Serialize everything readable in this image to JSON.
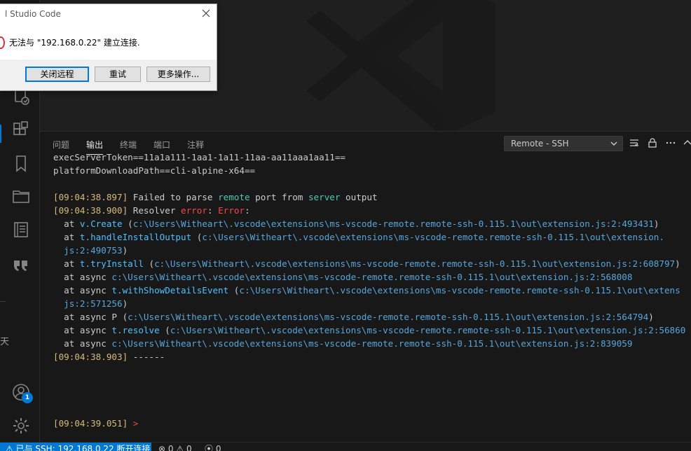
{
  "dialog": {
    "title": "l Studio Code",
    "message": "无法与 \"192.168.0.22\" 建立连接.",
    "buttons": [
      "关闭远程",
      "重试",
      "更多操作..."
    ]
  },
  "activity_bar": {
    "cut_char": "天",
    "accounts_badge": "1"
  },
  "panel": {
    "tabs": [
      "问题",
      "输出",
      "终端",
      "端口",
      "注释"
    ],
    "active_tab": "输出",
    "channel_select": "Remote - SSH"
  },
  "output": {
    "lines": [
      [
        {
          "t": "execServerToken==11a1a111-1aa1-1a11-11aa-aa11aaa1aa11=="
        }
      ],
      [
        {
          "t": "platformDownloadPath==cli-alpine-x64=="
        }
      ],
      [
        {
          "t": ""
        }
      ],
      [
        {
          "t": "[09:04:38.897]",
          "c": "ts"
        },
        {
          "t": " Failed to parse "
        },
        {
          "t": "remote",
          "c": "kw"
        },
        {
          "t": " port from "
        },
        {
          "t": "server",
          "c": "kw"
        },
        {
          "t": " output"
        }
      ],
      [
        {
          "t": "[09:04:38.900]",
          "c": "ts"
        },
        {
          "t": " Resolver "
        },
        {
          "t": "error",
          "c": "err"
        },
        {
          "t": ": "
        },
        {
          "t": "Error",
          "c": "err"
        },
        {
          "t": ":"
        }
      ],
      [
        {
          "t": "  at "
        },
        {
          "t": "v.Create",
          "c": "fn"
        },
        {
          "t": " ("
        },
        {
          "t": "c:\\Users\\Witheart\\.vscode\\extensions\\ms-vscode-remote.remote-ssh-0.115.1\\out\\extension.js:2:493431",
          "c": "path"
        },
        {
          "t": ")"
        }
      ],
      [
        {
          "t": "  at "
        },
        {
          "t": "t.handleInstallOutput",
          "c": "fn"
        },
        {
          "t": " ("
        },
        {
          "t": "c:\\Users\\Witheart\\.vscode\\extensions\\ms-vscode-remote.remote-ssh-0.115.1\\out\\extension.",
          "c": "path"
        }
      ],
      [
        {
          "t": "  js:2:490753",
          "c": "path"
        },
        {
          "t": ")"
        }
      ],
      [
        {
          "t": "  at "
        },
        {
          "t": "t.tryInstall",
          "c": "fn"
        },
        {
          "t": " ("
        },
        {
          "t": "c:\\Users\\Witheart\\.vscode\\extensions\\ms-vscode-remote.remote-ssh-0.115.1\\out\\extension.js:2:608797",
          "c": "path"
        },
        {
          "t": ")"
        }
      ],
      [
        {
          "t": "  at async "
        },
        {
          "t": "c:\\Users\\Witheart\\.vscode\\extensions\\ms-vscode-remote.remote-ssh-0.115.1\\out\\extension.js:2:568008",
          "c": "path"
        }
      ],
      [
        {
          "t": "  at async "
        },
        {
          "t": "t.withShowDetailsEvent",
          "c": "fn"
        },
        {
          "t": " ("
        },
        {
          "t": "c:\\Users\\Witheart\\.vscode\\extensions\\ms-vscode-remote.remote-ssh-0.115.1\\out\\extens",
          "c": "path"
        }
      ],
      [
        {
          "t": "  js:2:571256",
          "c": "path"
        },
        {
          "t": ")"
        }
      ],
      [
        {
          "t": "  at async P ("
        },
        {
          "t": "c:\\Users\\Witheart\\.vscode\\extensions\\ms-vscode-remote.remote-ssh-0.115.1\\out\\extension.js:2:564794",
          "c": "path"
        },
        {
          "t": ")"
        }
      ],
      [
        {
          "t": "  at async "
        },
        {
          "t": "t.resolve",
          "c": "fn"
        },
        {
          "t": " ("
        },
        {
          "t": "c:\\Users\\Witheart\\.vscode\\extensions\\ms-vscode-remote.remote-ssh-0.115.1\\out\\extension.js:2:56860",
          "c": "path"
        }
      ],
      [
        {
          "t": "  at async "
        },
        {
          "t": "c:\\Users\\Witheart\\.vscode\\extensions\\ms-vscode-remote.remote-ssh-0.115.1\\out\\extension.js:2:839059",
          "c": "path"
        }
      ],
      [
        {
          "t": "[09:04:38.903]",
          "c": "ts"
        },
        {
          "t": " ------"
        }
      ],
      [
        {
          "t": ""
        }
      ],
      [
        {
          "t": ""
        }
      ],
      [
        {
          "t": ""
        }
      ],
      [
        {
          "t": ""
        }
      ],
      [
        {
          "t": "[09:04:39.051]",
          "c": "ts"
        },
        {
          "t": " >",
          "c": "err"
        }
      ]
    ]
  },
  "status_bar": {
    "remote": "⚠ 已与 SSH: 192.168.0.22 断开连接",
    "errors": "0",
    "warnings": "0",
    "ports": "0"
  },
  "colors": {
    "accent": "#0078d4",
    "timestamp": "#d7ba7d",
    "keyword": "#4ec9b0",
    "error": "#f44747",
    "path": "#58a6dc"
  }
}
